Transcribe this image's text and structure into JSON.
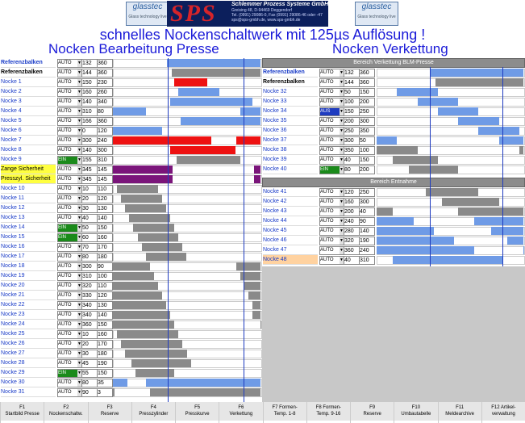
{
  "header": {
    "logo_left": {
      "name": "glasstec",
      "sub": "Glass technology live"
    },
    "logo_right": {
      "name": "glasstec",
      "sub": "Glass technology live"
    },
    "brand": {
      "sps": "SPS",
      "company": "Schlemmer Prozess Systeme GmbH",
      "address": "Greising 48, D-94469 Deggendorf",
      "contact": "Tel. (0991) 29086-0, Fax (0991) 29086-46 oder -47",
      "web": "sps@sps-gmbh.de, www.sps-gmbh.de"
    },
    "title": "schnelles Nockenschaltwerk mit 125µs Auflösung !",
    "left_title": "Nocken Bearbeitung Presse",
    "right_title": "Nocken Verkettung"
  },
  "left": {
    "rows": [
      {
        "label": "Referenzbalken",
        "mode": "AUTO",
        "v1": "132",
        "v2": "360",
        "color": "blue",
        "bold": true
      },
      {
        "label": "Referenzbalken",
        "mode": "AUTO",
        "v1": "144",
        "v2": "360",
        "color": "black",
        "bold": true
      },
      {
        "label": "Nocke 1",
        "mode": "AUTO",
        "v1": "150",
        "v2": "230",
        "color": "red"
      },
      {
        "label": "Nocke 2",
        "mode": "AUTO",
        "v1": "160",
        "v2": "260",
        "color": "blue"
      },
      {
        "label": "Nocke 3",
        "mode": "AUTO",
        "v1": "140",
        "v2": "340",
        "color": "blue"
      },
      {
        "label": "Nocke 4",
        "mode": "AUTO",
        "v1": "310",
        "v2": "80",
        "color": "blue"
      },
      {
        "label": "Nocke 5",
        "mode": "AUTO",
        "v1": "166",
        "v2": "360",
        "color": "blue"
      },
      {
        "label": "Nocke 6",
        "mode": "AUTO",
        "v1": "0",
        "v2": "120",
        "color": "blue"
      },
      {
        "label": "Nocke 7",
        "mode": "AUTO",
        "v1": "300",
        "v2": "240",
        "color": "red"
      },
      {
        "label": "Nocke 8",
        "mode": "AUTO",
        "v1": "140",
        "v2": "300",
        "color": "red"
      },
      {
        "label": "Nocke 9",
        "mode": "EIN",
        "v1": "155",
        "v2": "310",
        "color": "gray"
      },
      {
        "label": "Zange Sicherheit",
        "mode": "AUTO",
        "v1": "345",
        "v2": "145",
        "color": "purple",
        "yellow": true
      },
      {
        "label": "Presszyl. Sicherheit",
        "mode": "AUTO",
        "v1": "345",
        "v2": "145",
        "color": "purple",
        "yellow": true
      },
      {
        "label": "Nocke 10",
        "mode": "AUTO",
        "v1": "10",
        "v2": "110",
        "color": "gray"
      },
      {
        "label": "Nocke 11",
        "mode": "AUTO",
        "v1": "20",
        "v2": "120",
        "color": "gray"
      },
      {
        "label": "Nocke 12",
        "mode": "AUTO",
        "v1": "30",
        "v2": "130",
        "color": "gray"
      },
      {
        "label": "Nocke 13",
        "mode": "AUTO",
        "v1": "40",
        "v2": "140",
        "color": "gray"
      },
      {
        "label": "Nocke 14",
        "mode": "EIN",
        "v1": "50",
        "v2": "150",
        "color": "gray"
      },
      {
        "label": "Nocke 15",
        "mode": "EIN",
        "v1": "60",
        "v2": "160",
        "color": "gray"
      },
      {
        "label": "Nocke 16",
        "mode": "AUTO",
        "v1": "70",
        "v2": "170",
        "color": "gray"
      },
      {
        "label": "Nocke 17",
        "mode": "AUTO",
        "v1": "80",
        "v2": "180",
        "color": "gray"
      },
      {
        "label": "Nocke 18",
        "mode": "AUTO",
        "v1": "300",
        "v2": "90",
        "color": "gray"
      },
      {
        "label": "Nocke 19",
        "mode": "AUTO",
        "v1": "310",
        "v2": "100",
        "color": "gray"
      },
      {
        "label": "Nocke 20",
        "mode": "AUTO",
        "v1": "320",
        "v2": "110",
        "color": "gray"
      },
      {
        "label": "Nocke 21",
        "mode": "AUTO",
        "v1": "330",
        "v2": "120",
        "color": "gray"
      },
      {
        "label": "Nocke 22",
        "mode": "AUTO",
        "v1": "340",
        "v2": "130",
        "color": "gray"
      },
      {
        "label": "Nocke 23",
        "mode": "AUTO",
        "v1": "340",
        "v2": "140",
        "color": "gray"
      },
      {
        "label": "Nocke 24",
        "mode": "AUTO",
        "v1": "360",
        "v2": "150",
        "color": "gray"
      },
      {
        "label": "Nocke 25",
        "mode": "AUTO",
        "v1": "10",
        "v2": "160",
        "color": "gray"
      },
      {
        "label": "Nocke 26",
        "mode": "AUTO",
        "v1": "20",
        "v2": "170",
        "color": "gray"
      },
      {
        "label": "Nocke 27",
        "mode": "AUTO",
        "v1": "30",
        "v2": "180",
        "color": "gray"
      },
      {
        "label": "Nocke 28",
        "mode": "AUTO",
        "v1": "45",
        "v2": "190",
        "color": "gray"
      },
      {
        "label": "Nocke 29",
        "mode": "EIN",
        "v1": "55",
        "v2": "150",
        "color": "gray"
      },
      {
        "label": "Nocke 30",
        "mode": "AUTO",
        "v1": "80",
        "v2": "35",
        "color": "blue"
      },
      {
        "label": "Nocke 31",
        "mode": "AUTO",
        "v1": "90",
        "v2": "3",
        "color": "gray"
      }
    ]
  },
  "right": {
    "section1": "Bereich Verkettung BLM-Presse",
    "section2": "Bereich Entnahme",
    "rows1": [
      {
        "label": "Referenzbalken",
        "mode": "AUTO",
        "v1": "132",
        "v2": "360",
        "color": "blue",
        "bold": true
      },
      {
        "label": "Referenzbalken",
        "mode": "AUTO",
        "v1": "144",
        "v2": "360",
        "color": "black",
        "bold": true
      },
      {
        "label": "Nocke 32",
        "mode": "AUTO",
        "v1": "50",
        "v2": "150",
        "color": "blue"
      },
      {
        "label": "Nocke 33",
        "mode": "AUTO",
        "v1": "100",
        "v2": "200",
        "color": "blue"
      },
      {
        "label": "Nocke 34",
        "mode": "AUS",
        "v1": "150",
        "v2": "250",
        "color": "blue"
      },
      {
        "label": "Nocke 35",
        "mode": "AUTO",
        "v1": "200",
        "v2": "300",
        "color": "blue"
      },
      {
        "label": "Nocke 36",
        "mode": "AUTO",
        "v1": "250",
        "v2": "350",
        "color": "blue"
      },
      {
        "label": "Nocke 37",
        "mode": "AUTO",
        "v1": "300",
        "v2": "50",
        "color": "blue"
      },
      {
        "label": "Nocke 38",
        "mode": "AUTO",
        "v1": "350",
        "v2": "100",
        "color": "gray"
      },
      {
        "label": "Nocke 39",
        "mode": "AUTO",
        "v1": "40",
        "v2": "150",
        "color": "gray"
      },
      {
        "label": "Nocke 40",
        "mode": "EIN",
        "v1": "80",
        "v2": "200",
        "color": "gray"
      }
    ],
    "rows2": [
      {
        "label": "Nocke 41",
        "mode": "AUTO",
        "v1": "120",
        "v2": "250",
        "color": "gray"
      },
      {
        "label": "Nocke 42",
        "mode": "AUTO",
        "v1": "160",
        "v2": "300",
        "color": "gray"
      },
      {
        "label": "Nocke 43",
        "mode": "AUTO",
        "v1": "200",
        "v2": "40",
        "color": "gray"
      },
      {
        "label": "Nocke 44",
        "mode": "AUTO",
        "v1": "240",
        "v2": "90",
        "color": "blue"
      },
      {
        "label": "Nocke 45",
        "mode": "AUTO",
        "v1": "280",
        "v2": "140",
        "color": "blue"
      },
      {
        "label": "Nocke 46",
        "mode": "AUTO",
        "v1": "320",
        "v2": "190",
        "color": "blue"
      },
      {
        "label": "Nocke 47",
        "mode": "AUTO",
        "v1": "360",
        "v2": "240",
        "color": "blue"
      },
      {
        "label": "Nocke 48",
        "mode": "AUTO",
        "v1": "40",
        "v2": "310",
        "color": "blue",
        "peach": true
      }
    ]
  },
  "fkeys": [
    {
      "k": "F1",
      "l": "Startbild Presse"
    },
    {
      "k": "F2",
      "l": "Nockenschaltw."
    },
    {
      "k": "F3",
      "l": "Reserve"
    },
    {
      "k": "F4",
      "l": "Presszylinder"
    },
    {
      "k": "F5",
      "l": "Presskurve"
    },
    {
      "k": "F6",
      "l": "Verkettung"
    },
    {
      "k": "F7 Formen-",
      "l": "Temp. 1-8"
    },
    {
      "k": "F8 Formen-",
      "l": "Temp. 9-16"
    },
    {
      "k": "F9",
      "l": "Reserve"
    },
    {
      "k": "F10",
      "l": "Umbautabelle"
    },
    {
      "k": "F11",
      "l": "Meldearchive"
    },
    {
      "k": "F12 Artikel-",
      "l": "verwaltung"
    }
  ],
  "colors": {
    "blue": "#6f9be6",
    "red": "#ee1111",
    "gray": "#8a8a8a",
    "purple": "#7a157a",
    "black": "#8a8a8a"
  }
}
